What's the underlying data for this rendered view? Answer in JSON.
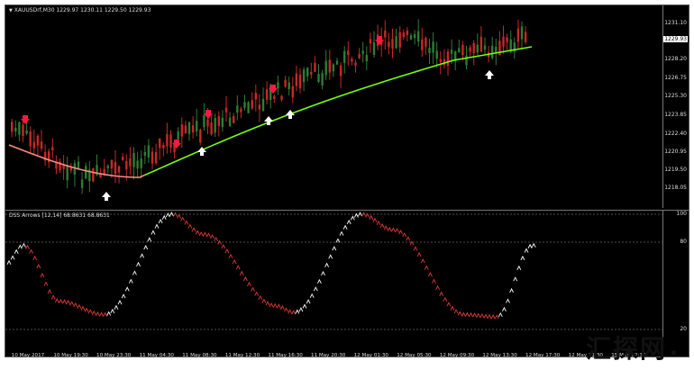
{
  "main_pane": {
    "title": "XAUUSDrf,M30  1229.97 1230.11 1229.50 1229.93",
    "price_labels": [
      "1231.10",
      "1228.20",
      "1226.75",
      "1225.30",
      "1223.85",
      "1222.40",
      "1220.95",
      "1219.50",
      "1218.05"
    ],
    "current_price": "1229.93",
    "bull_color": "#2e7d32",
    "bear_color": "#c62828",
    "ma_color_down": "#ff8a80",
    "ma_color_up": "#76ff03"
  },
  "indicator_pane": {
    "title": "DSS Arrows [12,14] 68.8631 68.8631",
    "levels": [
      "100",
      "80",
      "20"
    ],
    "up_color": "#ffffff",
    "down_color": "#e53935"
  },
  "time_axis": {
    "labels": [
      "10 May 2017",
      "10 May 19:30",
      "10 May 23:30",
      "11 May 04:30",
      "11 May 08:30",
      "11 May 12:30",
      "11 May 16:30",
      "11 May 20:30",
      "12 May 01:30",
      "12 May 05:30",
      "12 May 09:30",
      "12 May 13:30",
      "12 May 17:30",
      "12 May 21:30",
      "15 May 02:30"
    ]
  },
  "watermark": {
    "text": "汇探网",
    "dot": "."
  }
}
